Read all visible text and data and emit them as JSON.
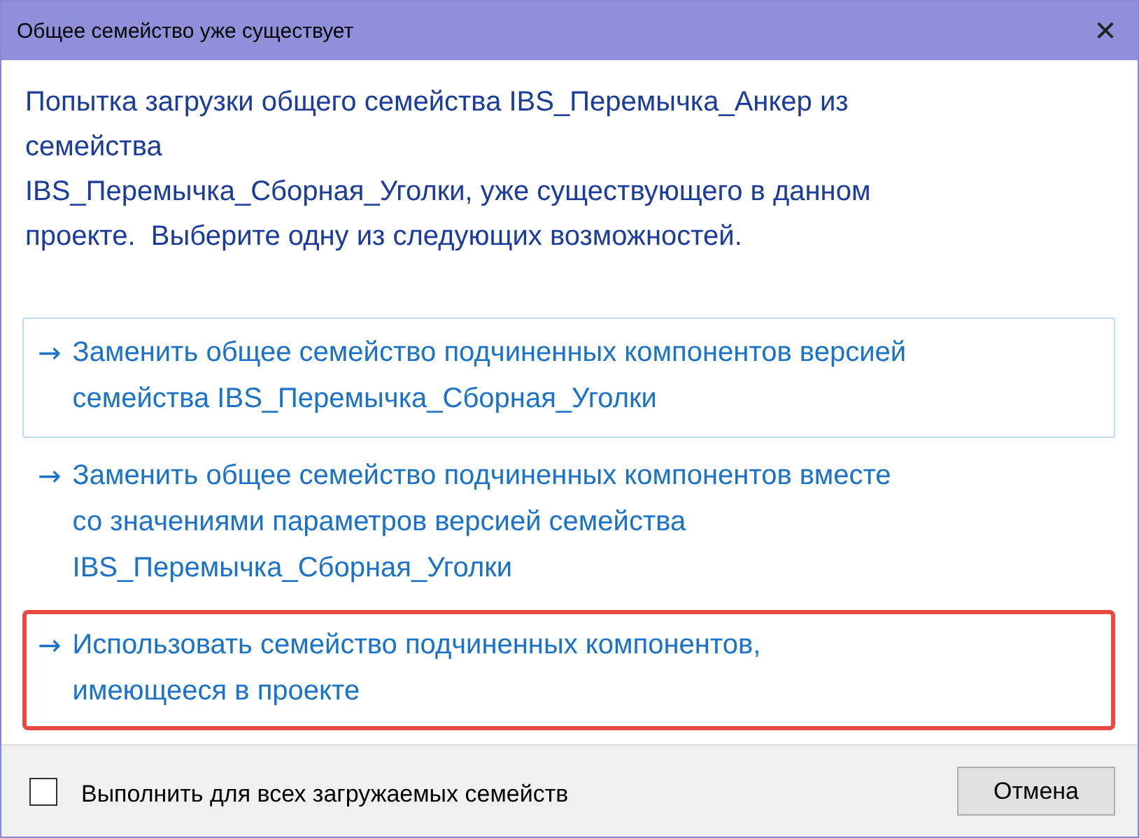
{
  "window": {
    "title": "Общее семейство уже существует",
    "close_glyph": "✕"
  },
  "instruction": [
    "Попытка загрузки общего семейства IBS_Перемычка_Анкер из",
    "семейства",
    "IBS_Перемычка_Сборная_Уголки, уже существующего в данном",
    "проекте.  Выберите одну из следующих возможностей."
  ],
  "options": [
    {
      "arrow": "→",
      "lines": [
        "Заменить общее семейство подчиненных компонентов версией",
        "семейства IBS_Перемычка_Сборная_Уголки"
      ],
      "hovered": true,
      "highlighted": false
    },
    {
      "arrow": "→",
      "lines": [
        "Заменить общее семейство подчиненных компонентов вместе",
        "со значениями параметров версией семейства",
        "IBS_Перемычка_Сборная_Уголки"
      ],
      "hovered": false,
      "highlighted": false
    },
    {
      "arrow": "→",
      "lines": [
        "Использовать семейство подчиненных компонентов,",
        "имеющееся в проекте"
      ],
      "hovered": false,
      "highlighted": true
    }
  ],
  "footer": {
    "checkbox": {
      "label": "Выполнить для всех загружаемых семейств",
      "checked": false
    },
    "cancel_button": "Отмена"
  }
}
